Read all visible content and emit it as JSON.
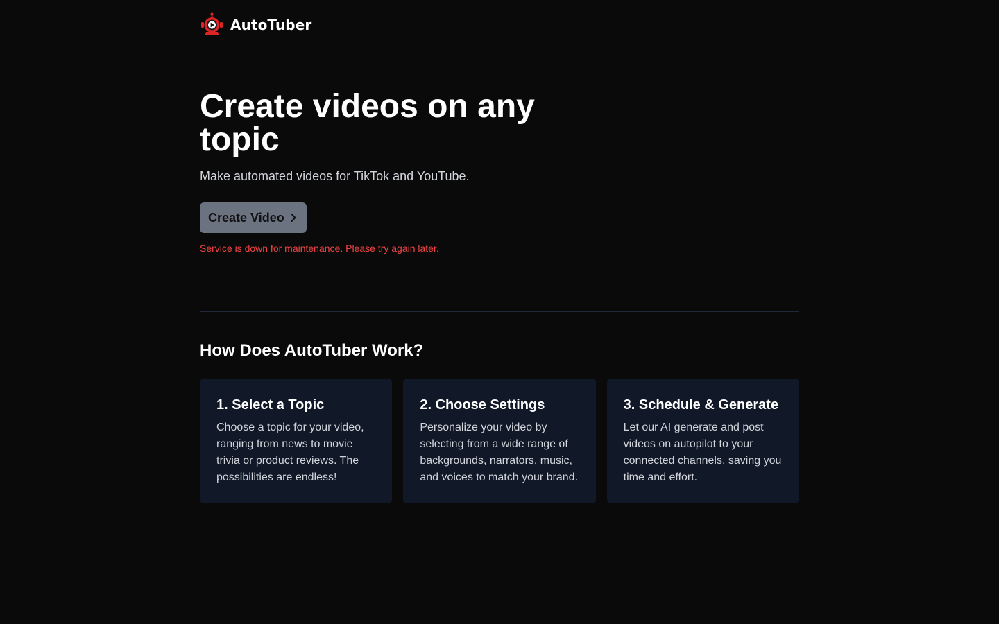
{
  "nav": {
    "brand": "AutoTuber",
    "logo_icon": "robot-play-icon"
  },
  "hero": {
    "title": "Create videos on any topic",
    "subtitle": "Make automated videos for TikTok and YouTube.",
    "cta_label": "Create Video",
    "cta_icon": "chevron-right-icon",
    "error": "Service is down for maintenance. Please try again later."
  },
  "how": {
    "title": "How Does AutoTuber Work?",
    "steps": [
      {
        "title": "1. Select a Topic",
        "text": "Choose a topic for your video, ranging from news to movie trivia or product reviews. The possibilities are endless!"
      },
      {
        "title": "2. Choose Settings",
        "text": "Personalize your video by selecting from a wide range of backgrounds, narrators, music, and voices to match your brand."
      },
      {
        "title": "3. Schedule & Generate",
        "text": "Let our AI generate and post videos on autopilot to your connected channels, saving you time and effort."
      }
    ]
  },
  "colors": {
    "background": "#0a0a0a",
    "logo_red": "#dc2626",
    "button_gray": "#6b7280",
    "error_red": "#ef4444",
    "card_bg": "#111827",
    "divider": "#1f2937"
  }
}
